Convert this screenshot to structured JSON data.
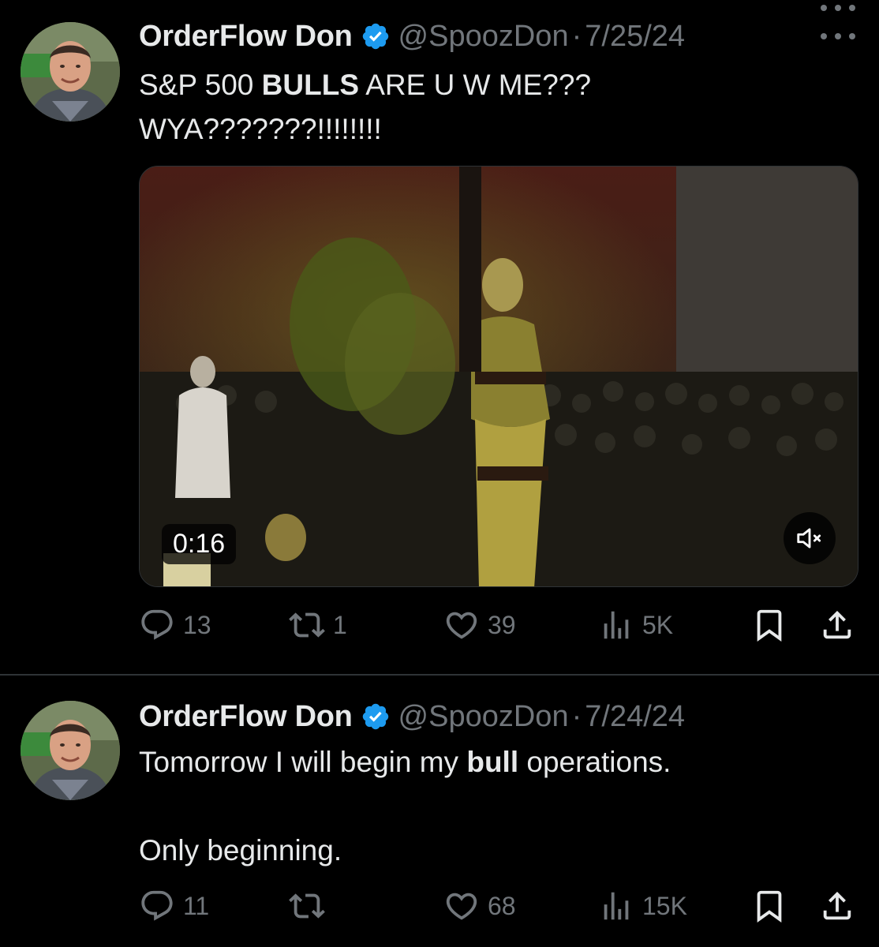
{
  "tweets": [
    {
      "author_name": "OrderFlow Don",
      "handle": "@SpoozDon",
      "separator": "·",
      "date": "7/25/24",
      "text_parts": [
        "S&P 500 ",
        "BULLS",
        " ARE U W ME???",
        "WYA???????!!!!!!!!"
      ],
      "media": {
        "type": "video",
        "duration": "0:16",
        "muted": true
      },
      "stats": {
        "replies": "13",
        "retweets": "1",
        "likes": "39",
        "views": "5K"
      }
    },
    {
      "author_name": "OrderFlow Don",
      "handle": "@SpoozDon",
      "separator": "·",
      "date": "7/24/24",
      "text_parts": [
        "Tomorrow I will begin my ",
        "bull",
        " operations.",
        "Only beginning."
      ],
      "stats": {
        "replies": "11",
        "retweets": "",
        "likes": "68",
        "views": "15K"
      }
    }
  ],
  "colors": {
    "background": "#000000",
    "text_primary": "#e7e9ea",
    "text_secondary": "#71767b",
    "verified_badge": "#1d9bf0",
    "divider": "#2f3336"
  },
  "icons": {
    "verified": "verified-badge-icon",
    "more": "more-options-icon",
    "reply": "reply-icon",
    "retweet": "retweet-icon",
    "like": "like-icon",
    "views": "views-icon",
    "bookmark": "bookmark-icon",
    "share": "share-icon",
    "mute": "volume-muted-icon"
  }
}
